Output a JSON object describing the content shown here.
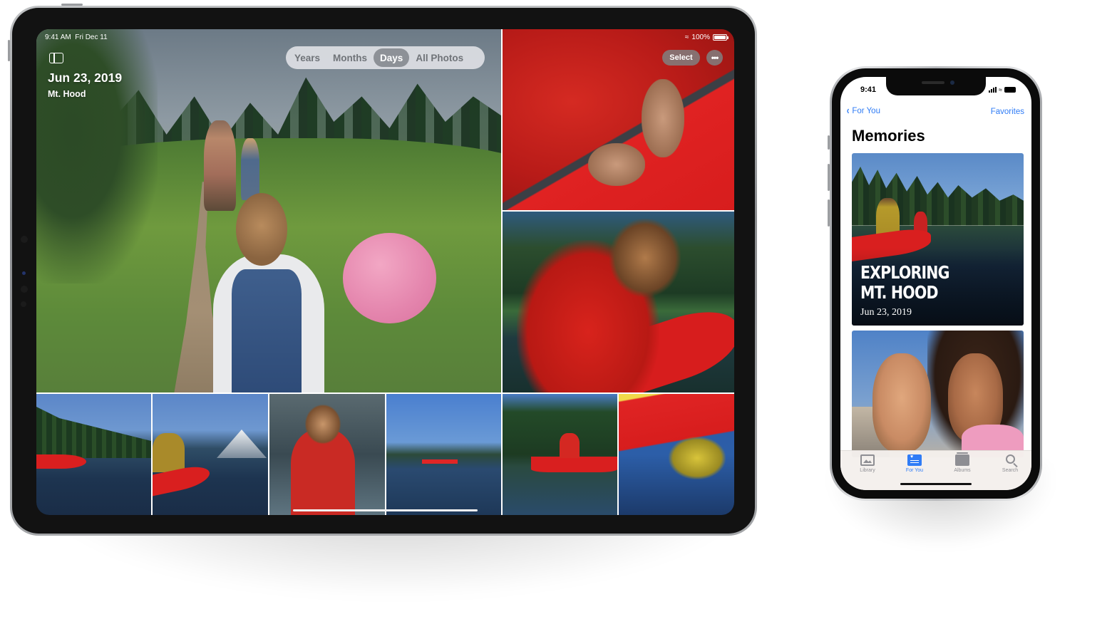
{
  "ipad": {
    "status_bar": {
      "time": "9:41 AM",
      "date": "Fri Dec 11",
      "battery": "100%",
      "wifi_icon": "wifi-icon",
      "battery_icon": "battery-icon"
    },
    "header": {
      "sidebar_icon": "sidebar-toggle-icon",
      "date_title": "Jun 23, 2019",
      "location": "Mt. Hood"
    },
    "segmented_control": {
      "items": [
        {
          "label": "Years",
          "active": false
        },
        {
          "label": "Months",
          "active": false
        },
        {
          "label": "Days",
          "active": true
        },
        {
          "label": "All Photos",
          "active": false
        }
      ]
    },
    "toolbar": {
      "select_label": "Select",
      "more_label": "•••"
    },
    "photos": [
      {
        "subject": "Child with pink balloon on hillside trail"
      },
      {
        "subject": "Hands on red canoe gunwale"
      },
      {
        "subject": "Woman in red jacket sitting in canoe"
      },
      {
        "subject": "Woman in red canoe on lake"
      },
      {
        "subject": "Two people in red canoe, mountain in background"
      },
      {
        "subject": "Woman in red hoodie in canoe"
      },
      {
        "subject": "Red canoe far out on lake"
      },
      {
        "subject": "Woman paddling red canoe near trees"
      },
      {
        "subject": "Red canoe reflection in water"
      }
    ]
  },
  "iphone": {
    "status_bar": {
      "time": "9:41"
    },
    "nav": {
      "back_label": "For You",
      "right_label": "Favorites"
    },
    "title": "Memories",
    "memories": [
      {
        "title_line1": "EXPLORING",
        "title_line2": "MT. HOOD",
        "date": "Jun 23, 2019"
      },
      {
        "subject": "Two friends smiling selfie"
      }
    ],
    "tab_bar": {
      "items": [
        {
          "label": "Library",
          "icon": "library-icon",
          "active": false
        },
        {
          "label": "For You",
          "icon": "for-you-icon",
          "active": true
        },
        {
          "label": "Albums",
          "icon": "albums-icon",
          "active": false
        },
        {
          "label": "Search",
          "icon": "search-icon",
          "active": false
        }
      ]
    }
  },
  "colors": {
    "ios_blue": "#2f7cf6",
    "canoe_red": "#d91f1f"
  }
}
